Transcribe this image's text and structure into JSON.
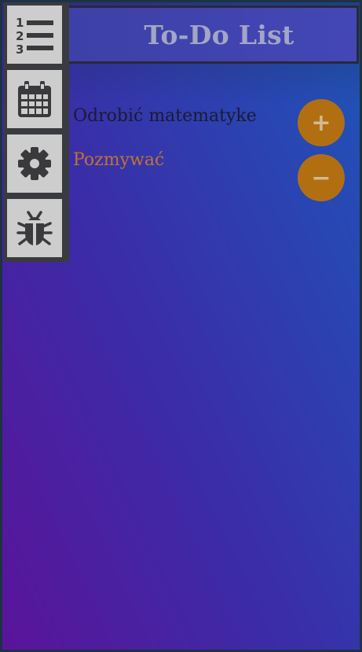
{
  "header": {
    "title": "To-Do List"
  },
  "sidebar": {
    "items": [
      {
        "icon": "numbered-list-icon"
      },
      {
        "icon": "calendar-icon"
      },
      {
        "icon": "gear-icon"
      },
      {
        "icon": "bug-icon"
      }
    ]
  },
  "tasks": [
    {
      "text": "Odrobić matematyke"
    },
    {
      "text": "Pozmywać"
    }
  ],
  "actions": {
    "add_label": "+",
    "remove_label": "−"
  },
  "colors": {
    "accent_button": "#b26f12",
    "sidebar_button": "#cdcdcd",
    "header_bg": "#4347b6",
    "task_highlight": "#c07430"
  }
}
